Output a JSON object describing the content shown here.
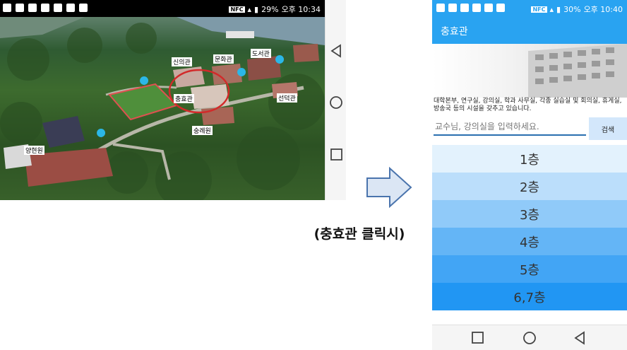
{
  "left_phone": {
    "status": {
      "battery": "29%",
      "time": "오후 10:34",
      "nfc": "NFC"
    },
    "map": {
      "labels": {
        "sinui": "신의관",
        "munhwa": "문화관",
        "doseo": "도서관",
        "chunghyo": "충효관",
        "seondeok": "선덕관",
        "sunglye": "숭례원",
        "yanghyeon": "양현원"
      }
    }
  },
  "caption": "(충효관 클릭시)",
  "right_phone": {
    "status": {
      "battery": "30%",
      "time": "오후 10:40",
      "nfc": "NFC"
    },
    "app_title": "충효관",
    "description": "대학본부, 연구실, 강의실, 학과 사무실, 각종 실습실 및 회의실, 휴게실, 방송국 등의 시설을 갖추고 있습니다.",
    "search": {
      "placeholder": "교수님, 강의실을 입력하세요.",
      "button_label": "검색"
    },
    "floors": [
      {
        "label": "1층",
        "color": "#e3f2fd"
      },
      {
        "label": "2층",
        "color": "#bbdefb"
      },
      {
        "label": "3층",
        "color": "#90caf9"
      },
      {
        "label": "4층",
        "color": "#64b5f6"
      },
      {
        "label": "5층",
        "color": "#42a5f5"
      },
      {
        "label": "6,7층",
        "color": "#2196f3"
      }
    ]
  },
  "colors": {
    "accent": "#29a3f1",
    "pin": "#2bb7e8",
    "arrow_fill": "#dbe6f4",
    "arrow_stroke": "#4a74ad"
  }
}
